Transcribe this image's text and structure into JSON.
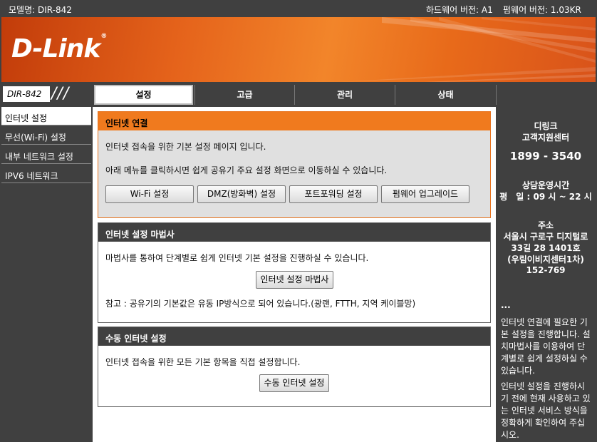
{
  "topbar": {
    "model": "모델명: DIR-842",
    "hardware": "하드웨어 버전: A1",
    "firmware": "펌웨어 버전: 1.03KR"
  },
  "brand": {
    "logo": "D-Link",
    "reg": "®"
  },
  "nav": {
    "model_label": "DIR-842",
    "slashes": "///",
    "tabs": [
      "설정",
      "고급",
      "관리",
      "상태"
    ]
  },
  "sidebar": {
    "items": [
      "인터넷 설정",
      "무선(Wi-Fi) 설정",
      "내부 네트워크 설정",
      "IPV6 네트워크"
    ]
  },
  "section1": {
    "title": "인터넷 연결",
    "line1": "인터넷 접속을 위한 기본 설정 페이지 입니다.",
    "line2": "아래 메뉴를 클릭하시면 쉽게 공유기 주요 설정 화면으로 이동하실 수 있습니다.",
    "buttons": [
      "Wi-Fi 설정",
      "DMZ(방화벽) 설정",
      "포트포워딩 설정",
      "펌웨어 업그레이드"
    ]
  },
  "section2": {
    "title": "인터넷 설정 마법사",
    "line1": "마법사를 통하여 단계별로 쉽게 인터넷 기본 설정을 진행하실 수 있습니다.",
    "button": "인터넷 설정 마법사",
    "note": "참고 : 공유기의 기본값은 유동 IP방식으로 되어 있습니다.(광랜, FTTH, 지역 케이블망)"
  },
  "section3": {
    "title": "수동 인터넷 설정",
    "line1": "인터넷 접속을 위한 모든 기본 항목을 직접 설정합니다.",
    "button": "수동 인터넷 설정"
  },
  "right": {
    "company": "디링크",
    "center": "고객지원센터",
    "phone": "1899 - 3540",
    "hours_title": "상담운영시간",
    "hours": "평　일 : 09 시 ~ 22 시",
    "addr_title": "주소",
    "addr1": "서울시 구로구 디지털로",
    "addr2": "33길 28 1401호",
    "addr3": "(우림이비지센터1차)",
    "addr4": "152-769",
    "ellipsis": "...",
    "help1": "인터넷 연결에 필요한 기본 설정을 진행합니다. 설치마법사를 이용하여 단계별로 쉽게 설정하실 수 있습니다.",
    "help2": "인터넷 설정을 진행하시기 전에 현재 사용하고 있는 인터넷 서비스 방식을 정확하게 확인하여 주십시오."
  }
}
